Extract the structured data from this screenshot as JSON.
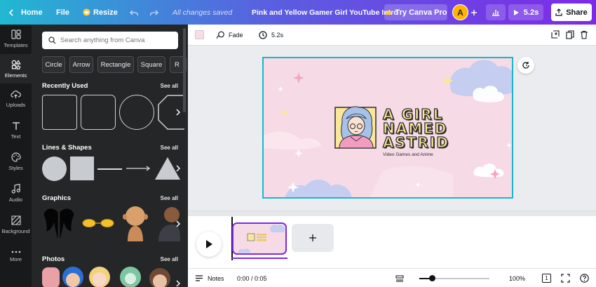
{
  "topbar": {
    "home_label": "Home",
    "file_label": "File",
    "resize_label": "Resize",
    "save_status": "All changes saved",
    "doc_title": "Pink and Yellow Gamer Girl YouTube Intro",
    "try_pro_label": "Try Canva Pro",
    "avatar_initial": "A",
    "duration_label": "5.2s",
    "share_label": "Share"
  },
  "rail": {
    "items": [
      {
        "label": "Templates",
        "icon": "templates-icon"
      },
      {
        "label": "Elements",
        "icon": "elements-icon"
      },
      {
        "label": "Uploads",
        "icon": "upload-cloud-icon"
      },
      {
        "label": "Text",
        "icon": "text-icon"
      },
      {
        "label": "Styles",
        "icon": "styles-icon"
      },
      {
        "label": "Audio",
        "icon": "audio-icon"
      },
      {
        "label": "Background",
        "icon": "background-icon"
      },
      {
        "label": "More",
        "icon": "more-dots-icon"
      }
    ]
  },
  "panel": {
    "search_placeholder": "Search anything from Canva",
    "chips": [
      "Circle",
      "Arrow",
      "Rectangle",
      "Square",
      "R"
    ],
    "sections": {
      "recent": {
        "title": "Recently Used",
        "see_all": "See all"
      },
      "lines": {
        "title": "Lines & Shapes",
        "see_all": "See all"
      },
      "graphics": {
        "title": "Graphics",
        "see_all": "See all"
      },
      "photos": {
        "title": "Photos",
        "see_all": "See all"
      }
    }
  },
  "toolbar": {
    "fade_label": "Fade",
    "duration_label": "5.2s",
    "bg_color": "#f8dde6"
  },
  "design": {
    "title_line1": "A GIRL",
    "title_line2": "NAMED",
    "title_line3": "ASTRID",
    "subtitle": "Video Games and Anime"
  },
  "footer": {
    "notes_label": "Notes",
    "time_label": "0:00 / 0:05",
    "zoom_label": "100%",
    "page_count": "1"
  },
  "colors": {
    "accent": "#7d2ae8",
    "selection": "#19b7c9",
    "design_bg": "#f6dbe7",
    "title_fill": "#fae79b"
  }
}
